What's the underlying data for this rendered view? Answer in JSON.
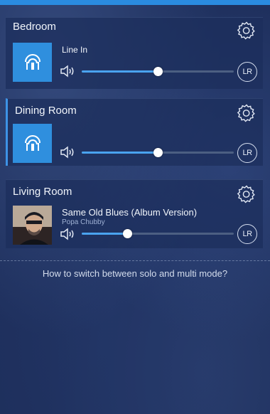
{
  "colors": {
    "accent": "#2f8fde",
    "slider_fill": "#4aa3ef",
    "background": "#1e2f5c"
  },
  "rooms": [
    {
      "name": "Bedroom",
      "source_icon": "wifi-speaker-icon",
      "now_playing_title": "Line In",
      "now_playing_artist": "",
      "volume": 0.5,
      "channel_label": "LR",
      "selected": false
    },
    {
      "name": "Dining Room",
      "source_icon": "wifi-speaker-icon",
      "now_playing_title": "",
      "now_playing_artist": "",
      "volume": 0.5,
      "channel_label": "LR",
      "selected": true
    },
    {
      "name": "Living Room",
      "source_icon": "album-art",
      "now_playing_title": "Same Old Blues (Album Version)",
      "now_playing_artist": "Popa Chubby",
      "volume": 0.3,
      "channel_label": "LR",
      "selected": false
    }
  ],
  "help_link": "How to switch between solo and multi mode?"
}
